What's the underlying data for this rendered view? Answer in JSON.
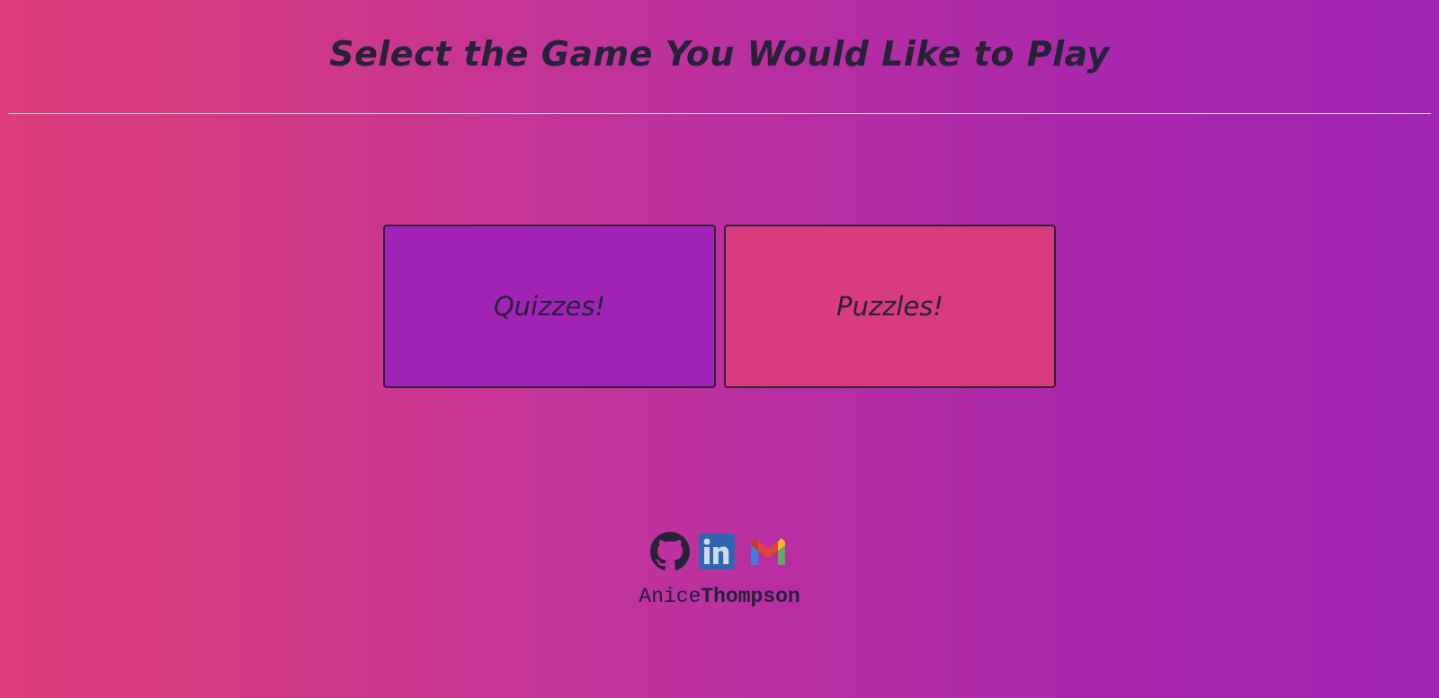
{
  "header": {
    "title": "Select the Game You Would Like to Play"
  },
  "games": [
    {
      "label": "Quizzes!",
      "color": "#a023b6"
    },
    {
      "label": "Puzzles!",
      "color": "#d93c7e"
    }
  ],
  "footer": {
    "social": [
      {
        "name": "github-icon"
      },
      {
        "name": "linkedin-icon"
      },
      {
        "name": "gmail-icon"
      }
    ],
    "author_first": "Anice",
    "author_last": "Thompson"
  },
  "colors": {
    "gradient_start": "#dc3b7c",
    "gradient_end": "#a124b4",
    "text_dark": "#262238",
    "linkedin_blue": "#2f66b3"
  }
}
